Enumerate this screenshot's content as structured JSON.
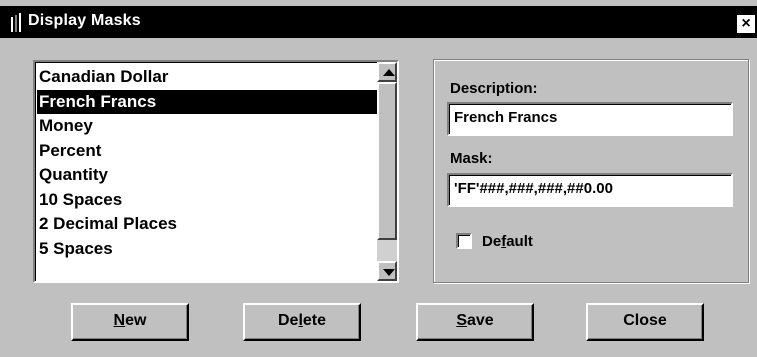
{
  "window": {
    "title": "Display Masks",
    "close_glyph": "×"
  },
  "list": {
    "items": [
      "Canadian Dollar",
      "French Francs",
      "Money",
      "Percent",
      "Quantity",
      "10 Spaces",
      "2 Decimal Places",
      "5 Spaces"
    ],
    "selected_index": 1
  },
  "form": {
    "description_label": "Description:",
    "description_value": "French Francs",
    "mask_label": "Mask:",
    "mask_value": "'FF'###,###,###,##0.00",
    "default_label_pre": "De",
    "default_label_accel": "f",
    "default_label_post": "ault",
    "default_checked": false
  },
  "buttons": {
    "new": {
      "accel": "N",
      "rest": "ew"
    },
    "delete": {
      "pre": "De",
      "accel": "l",
      "post": "ete"
    },
    "save": {
      "accel": "S",
      "rest": "ave"
    },
    "close": "Close"
  },
  "icons": {
    "title": "app-icon",
    "close": "close-icon"
  }
}
